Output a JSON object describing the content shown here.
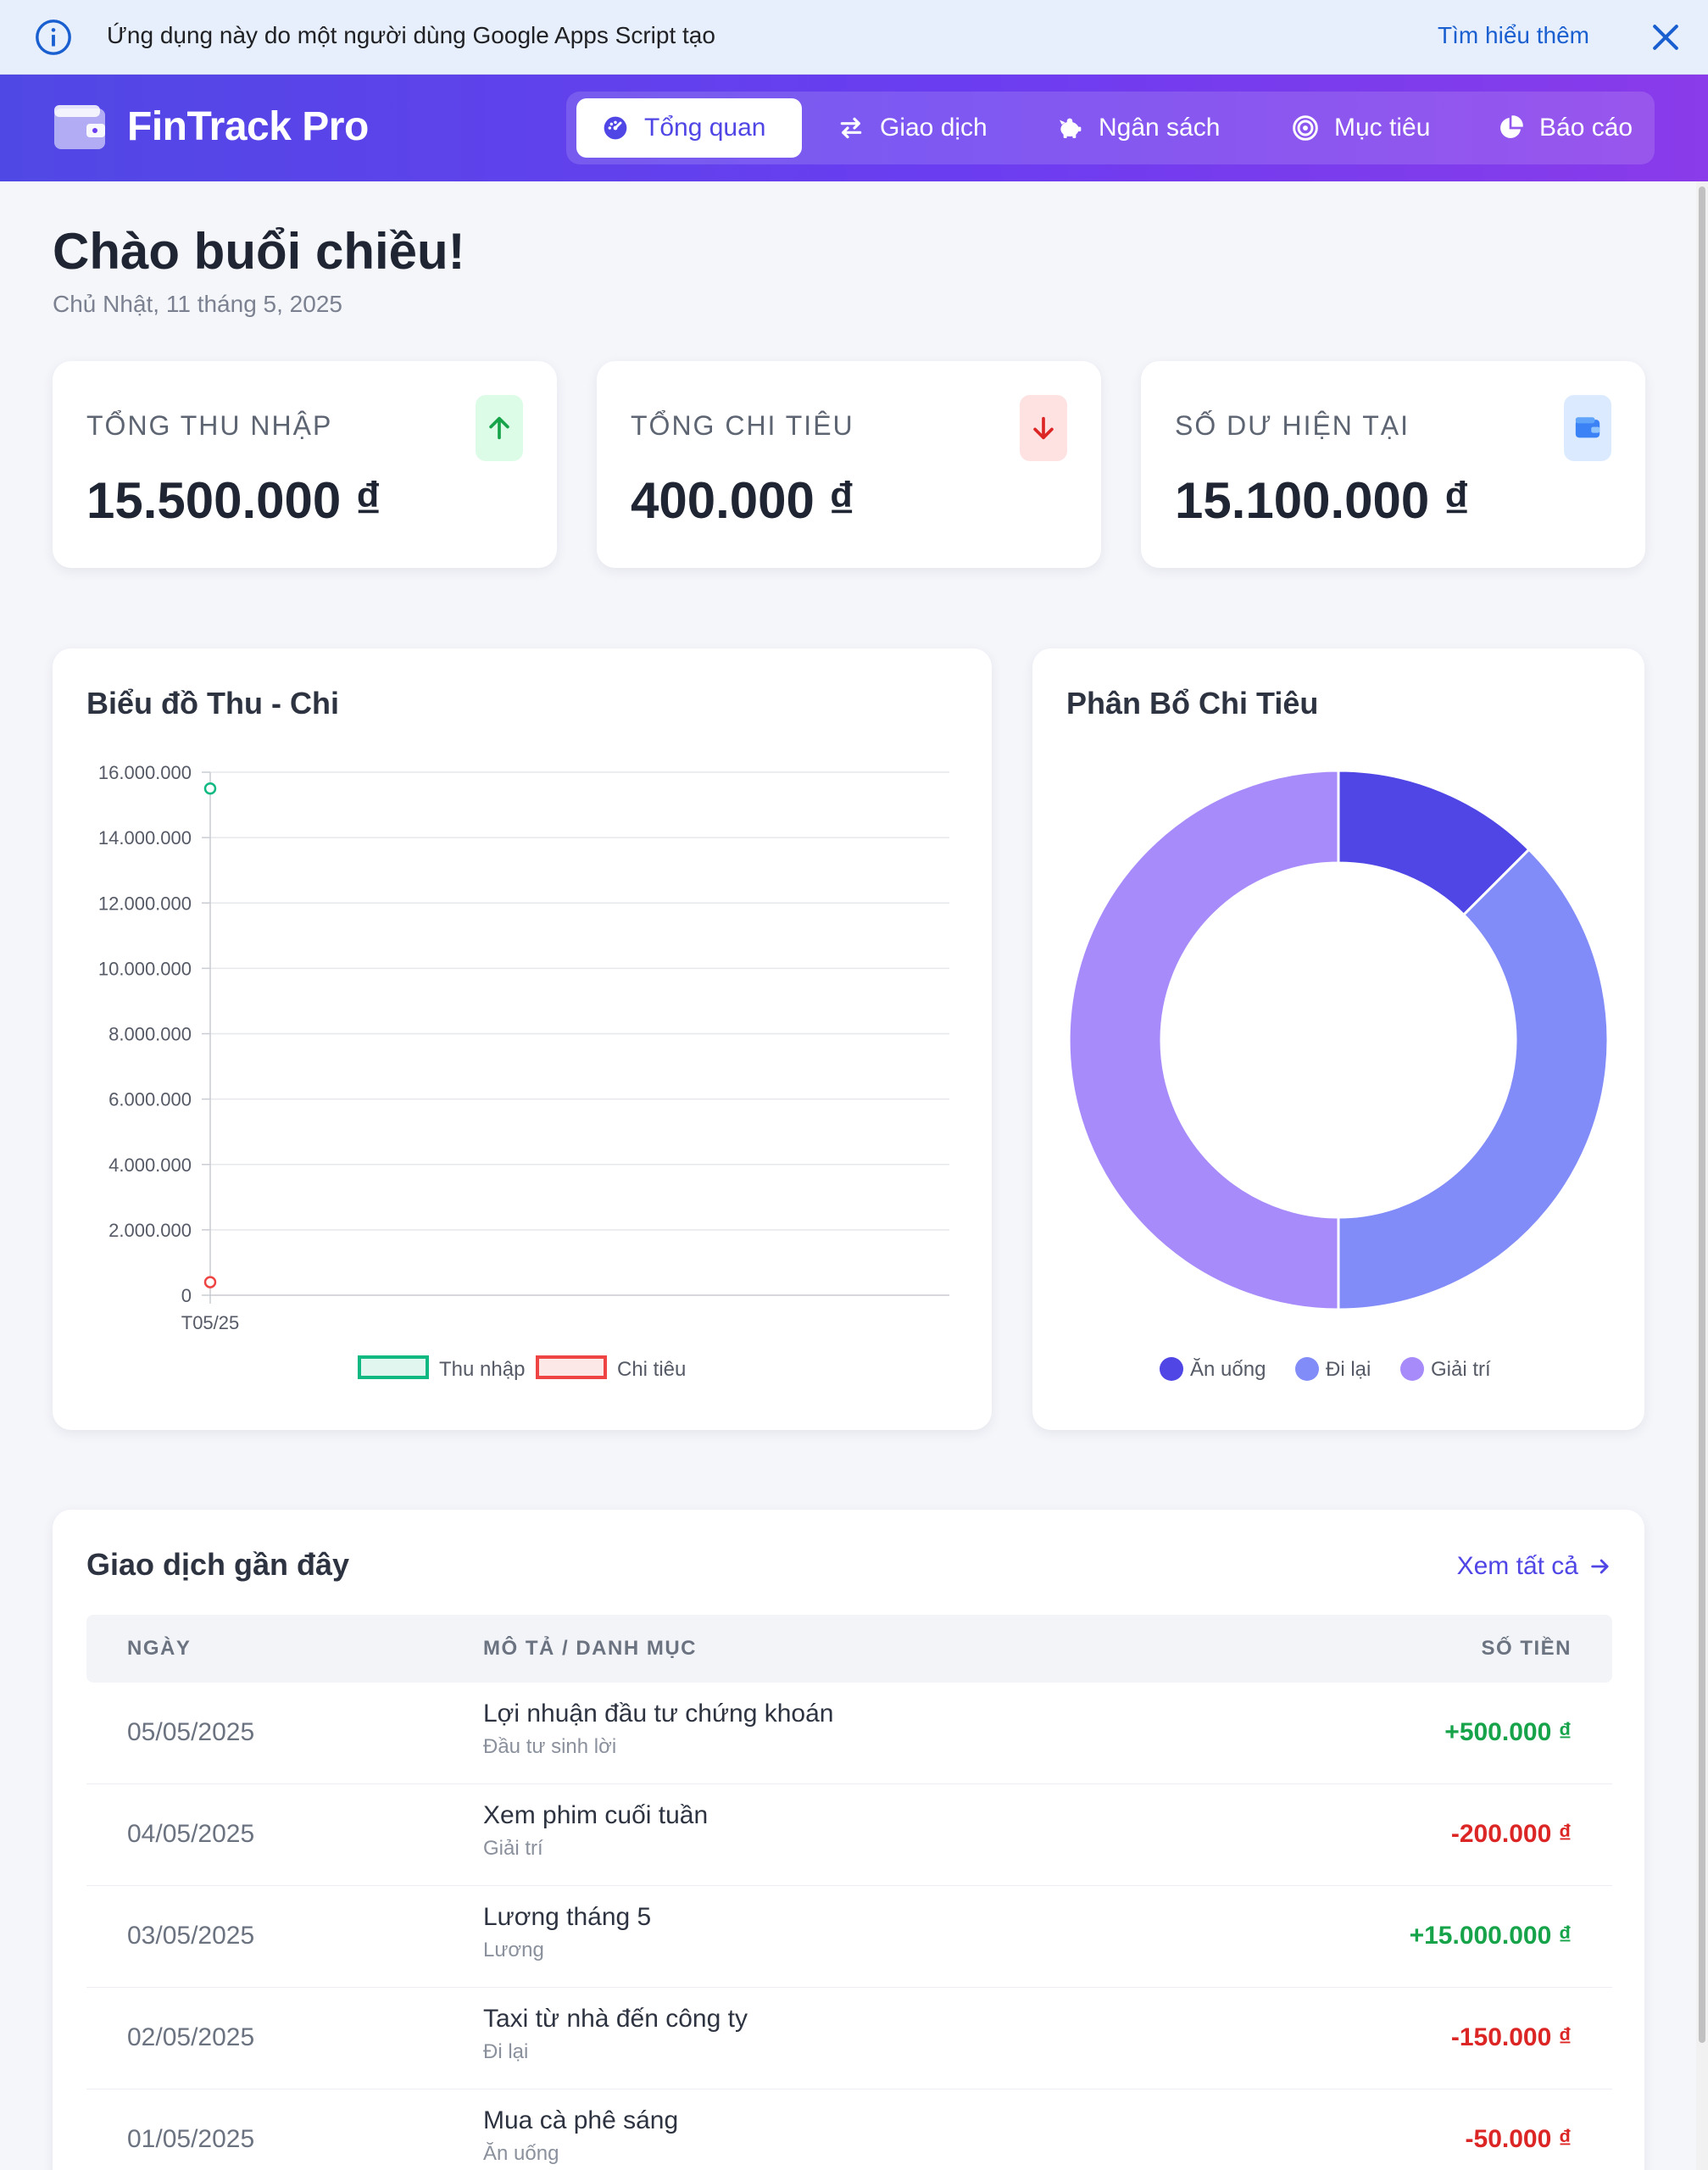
{
  "banner": {
    "message": "Ứng dụng này do một người dùng Google Apps Script tạo",
    "learn_more": "Tìm hiểu thêm"
  },
  "header": {
    "brand": "FinTrack Pro",
    "nav": [
      {
        "label": "Tổng quan",
        "icon": "gauge-icon",
        "active": true
      },
      {
        "label": "Giao dịch",
        "icon": "exchange-icon"
      },
      {
        "label": "Ngân sách",
        "icon": "piggy-bank-icon"
      },
      {
        "label": "Mục tiêu",
        "icon": "target-icon"
      },
      {
        "label": "Báo cáo",
        "icon": "pie-chart-icon"
      }
    ]
  },
  "greeting": {
    "title": "Chào buổi chiều!",
    "date": "Chủ Nhật, 11 tháng 5, 2025"
  },
  "stats": [
    {
      "label": "TỔNG THU NHẬP",
      "value": "15.500.000 ₫",
      "icon": "arrow-up-icon",
      "color": "#16a34a"
    },
    {
      "label": "TỔNG CHI TIÊU",
      "value": "400.000 ₫",
      "icon": "arrow-down-icon",
      "color": "#dc2626"
    },
    {
      "label": "SỐ DƯ HIỆN TẠI",
      "value": "15.100.000 ₫",
      "icon": "wallet-icon",
      "color": "#3b82f6"
    }
  ],
  "charts": {
    "line_title": "Biểu đồ Thu - Chi",
    "donut_title": "Phân Bổ Chi Tiêu"
  },
  "chart_data": [
    {
      "type": "line",
      "title": "Biểu đồ Thu - Chi",
      "x": [
        "T05/25"
      ],
      "series": [
        {
          "name": "Thu nhập",
          "values": [
            15500000
          ],
          "color": "#10b981"
        },
        {
          "name": "Chi tiêu",
          "values": [
            400000
          ],
          "color": "#ef4444"
        }
      ],
      "ylim": [
        0,
        16000000
      ],
      "yticks": [
        0,
        2000000,
        4000000,
        6000000,
        8000000,
        10000000,
        12000000,
        14000000,
        16000000
      ],
      "ytick_labels": [
        "0",
        "2.000.000",
        "4.000.000",
        "6.000.000",
        "8.000.000",
        "10.000.000",
        "12.000.000",
        "14.000.000",
        "16.000.000"
      ],
      "grid": true,
      "legend": "bottom"
    },
    {
      "type": "pie",
      "title": "Phân Bổ Chi Tiêu",
      "donut": true,
      "categories": [
        "Ăn uống",
        "Đi lại",
        "Giải trí"
      ],
      "values": [
        50000,
        150000,
        200000
      ],
      "colors": [
        "#4f46e5",
        "#818cf8",
        "#a78bfa"
      ],
      "legend": "bottom"
    }
  ],
  "transactions": {
    "title": "Giao dịch gần đây",
    "view_all": "Xem tất cả",
    "headers": {
      "date": "NGÀY",
      "desc": "MÔ TẢ / DANH MỤC",
      "amount": "SỐ TIỀN"
    },
    "rows": [
      {
        "date": "05/05/2025",
        "desc": "Lợi nhuận đầu tư chứng khoán",
        "category": "Đầu tư sinh lời",
        "amount": "+500.000 ₫",
        "positive": true
      },
      {
        "date": "04/05/2025",
        "desc": "Xem phim cuối tuần",
        "category": "Giải trí",
        "amount": "-200.000 ₫",
        "positive": false
      },
      {
        "date": "03/05/2025",
        "desc": "Lương tháng 5",
        "category": "Lương",
        "amount": "+15.000.000 ₫",
        "positive": true
      },
      {
        "date": "02/05/2025",
        "desc": "Taxi từ nhà đến công ty",
        "category": "Đi lại",
        "amount": "-150.000 ₫",
        "positive": false
      },
      {
        "date": "01/05/2025",
        "desc": "Mua cà phê sáng",
        "category": "Ăn uống",
        "amount": "-50.000 ₫",
        "positive": false
      }
    ]
  }
}
